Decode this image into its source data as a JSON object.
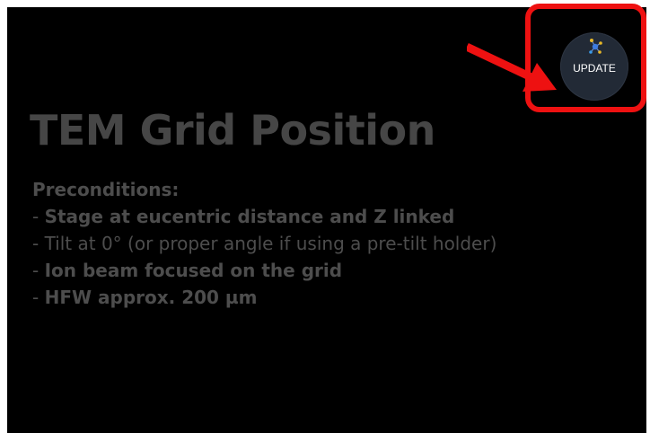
{
  "page": {
    "title": "TEM Grid Position",
    "preconditions_heading": "Preconditions:",
    "preconditions": [
      {
        "dash": "- ",
        "text": "Stage at eucentric distance and Z linked"
      },
      {
        "dash": "- ",
        "text": "Tilt at 0° (or proper angle if using a pre-tilt holder)"
      },
      {
        "dash": "- ",
        "text": "Ion beam focused on the grid"
      },
      {
        "dash": "- ",
        "text": "HFW approx. 200 µm"
      }
    ]
  },
  "update_button": {
    "label": "UPDATE",
    "icon": "molecule-icon"
  },
  "annotation": {
    "highlight_color": "#ee1111"
  },
  "colors": {
    "background": "#000000",
    "title_text": "#464646",
    "body_text": "#4d4d4d",
    "button_bg": "#222a36"
  }
}
